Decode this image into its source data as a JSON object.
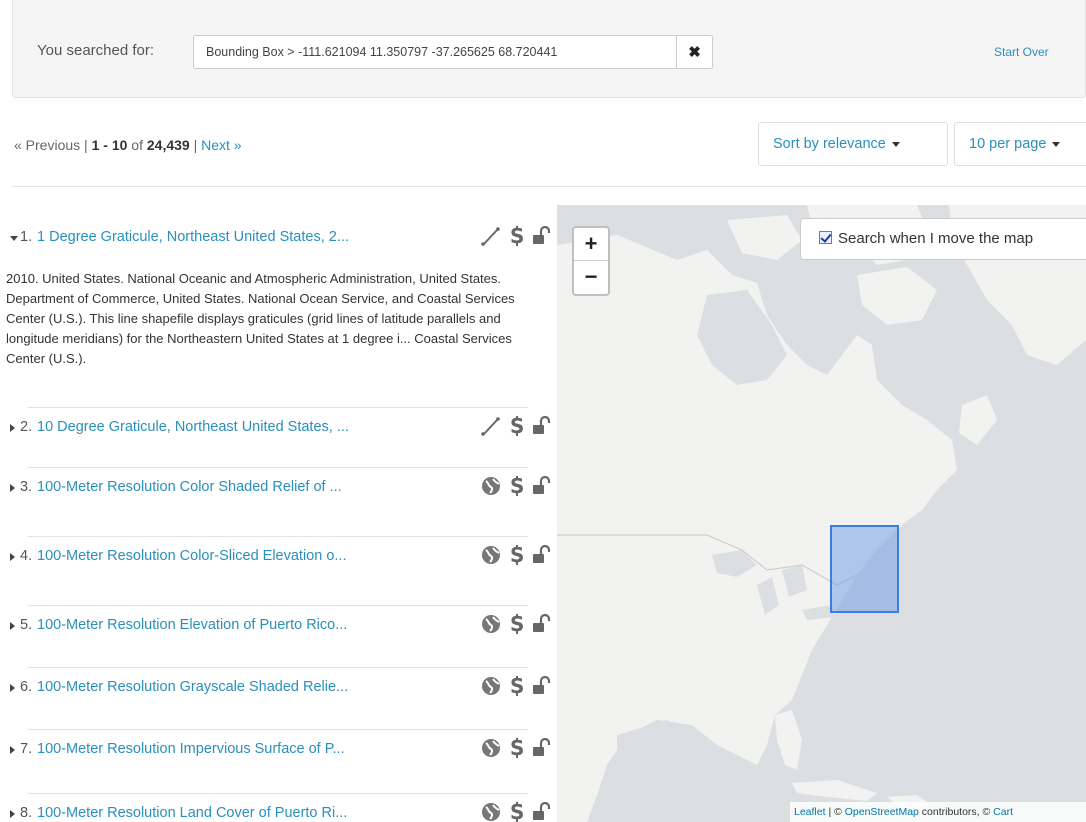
{
  "search": {
    "label": "You searched for:",
    "constraint_value": "Bounding Box > -111.621094 11.350797 -37.265625 68.720441",
    "remove_glyph": "✖",
    "start_over": "Start Over"
  },
  "paging": {
    "previous": "« Previous",
    "range_start": "1",
    "range_end": "10",
    "of": "of",
    "total": "24,439",
    "next": "Next »"
  },
  "sort": {
    "label": "Sort by relevance"
  },
  "per_page": {
    "label": "10 per page"
  },
  "results": [
    {
      "num": "1.",
      "title": "1 Degree Graticule, Northeast United States, 2...",
      "expanded": true,
      "type_icon": "line-icon",
      "description": "2010. United States. National Oceanic and Atmospheric Administration, United States. Department of Commerce, United States. National Ocean Service, and Coastal Services Center (U.S.). This line shapefile displays graticules (grid lines of latitude parallels and longitude meridians) for the Northeastern United States at 1 degree i... Coastal Services Center (U.S.)."
    },
    {
      "num": "2.",
      "title": "10 Degree Graticule, Northeast United States, ...",
      "expanded": false,
      "type_icon": "line-icon"
    },
    {
      "num": "3.",
      "title": "100-Meter Resolution Color Shaded Relief of ...",
      "expanded": false,
      "type_icon": "globe-icon"
    },
    {
      "num": "4.",
      "title": "100-Meter Resolution Color-Sliced Elevation o...",
      "expanded": false,
      "type_icon": "globe-icon"
    },
    {
      "num": "5.",
      "title": "100-Meter Resolution Elevation of Puerto Rico...",
      "expanded": false,
      "type_icon": "globe-icon"
    },
    {
      "num": "6.",
      "title": "100-Meter Resolution Grayscale Shaded Relie...",
      "expanded": false,
      "type_icon": "globe-icon"
    },
    {
      "num": "7.",
      "title": "100-Meter Resolution Impervious Surface of P...",
      "expanded": false,
      "type_icon": "globe-icon"
    },
    {
      "num": "8.",
      "title": "100-Meter Resolution Land Cover of Puerto Ri...",
      "expanded": false,
      "type_icon": "globe-icon"
    }
  ],
  "map": {
    "zoom_in": "+",
    "zoom_out": "−",
    "search_when_move": "Search when I move the map",
    "search_when_move_checked": true,
    "attribution_leaflet": "Leaflet",
    "attribution_sep": " | © ",
    "attribution_osm": "OpenStreetMap",
    "attribution_contrib": " contributors, © ",
    "attribution_carto": "Cart"
  },
  "colors": {
    "link": "#2a8fbd",
    "bbox_fill": "#a9c4ee",
    "bbox_stroke": "#3b7de0",
    "land": "#f2f2f0",
    "water": "#dbdfe2"
  }
}
